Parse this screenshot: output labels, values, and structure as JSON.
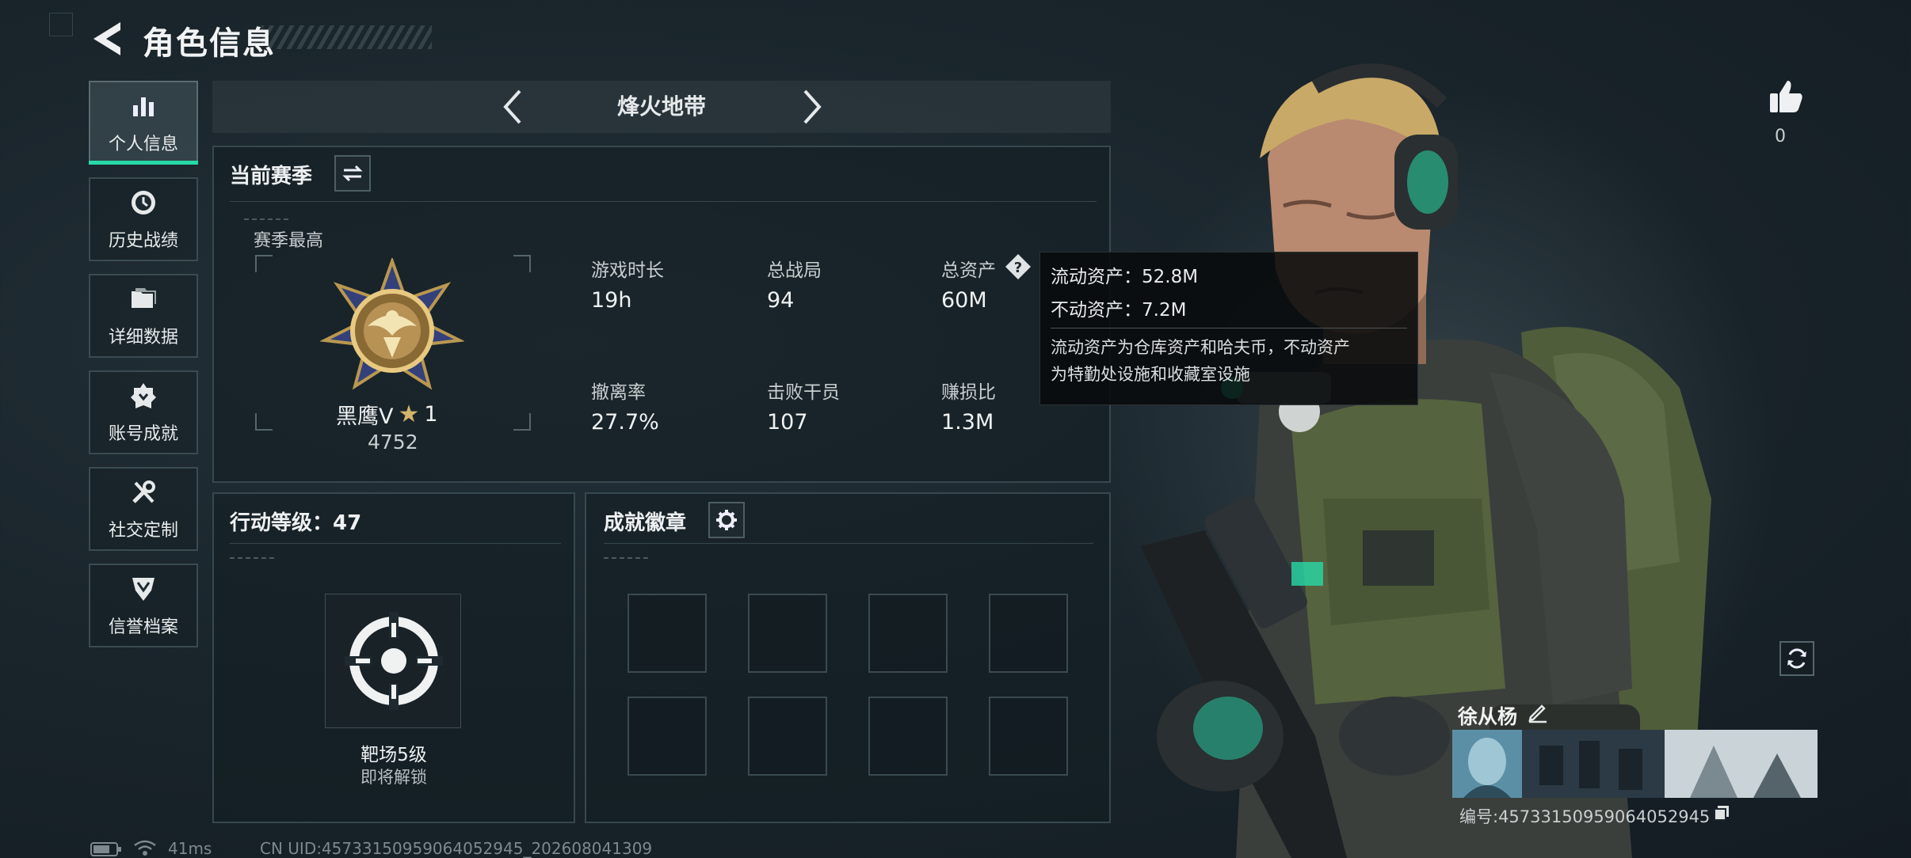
{
  "header": {
    "title": "角色信息"
  },
  "sidebar": {
    "items": [
      {
        "label": "个人信息",
        "active": true,
        "icon": "bar-chart-icon"
      },
      {
        "label": "历史战绩",
        "active": false,
        "icon": "history-clock-icon"
      },
      {
        "label": "详细数据",
        "active": false,
        "icon": "folder-icon"
      },
      {
        "label": "账号成就",
        "active": false,
        "icon": "achievement-icon"
      },
      {
        "label": "社交定制",
        "active": false,
        "icon": "tools-icon"
      },
      {
        "label": "信誉档案",
        "active": false,
        "icon": "reputation-shield-icon"
      }
    ]
  },
  "mode": {
    "title": "烽火地带"
  },
  "season": {
    "section_title": "当前赛季",
    "best_label": "赛季最高",
    "rank_name": "黑鹰V",
    "rank_star": "★",
    "rank_stars": "1",
    "rank_score": "4752",
    "stats": [
      {
        "label": "游戏时长",
        "value": "19h"
      },
      {
        "label": "总战局",
        "value": "94"
      },
      {
        "label": "总资产",
        "value": "60M"
      },
      {
        "label": "撤离率",
        "value": "27.7%"
      },
      {
        "label": "击败干员",
        "value": "107"
      },
      {
        "label": "赚损比",
        "value": "1.3M"
      }
    ]
  },
  "tooltip": {
    "liquid": "流动资产：52.8M",
    "fixed": "不动资产：7.2M",
    "desc_line1": "流动资产为仓库资产和哈夫币，不动资产",
    "desc_line2": "为特勤处设施和收藏室设施"
  },
  "level": {
    "title": "行动等级：47",
    "target_name": "靶场5级",
    "target_status": "即将解锁"
  },
  "badges": {
    "title": "成就徽章",
    "slot_count": 8
  },
  "profile": {
    "likes": "0",
    "name": "徐从杨",
    "card_id": "编号:45733150959064052945"
  },
  "status_bar": {
    "ping": "41ms",
    "uid": "CN UID:45733150959064052945_202608041309"
  },
  "colors": {
    "accent": "#27d9a6",
    "panel_border": "#37484e"
  }
}
